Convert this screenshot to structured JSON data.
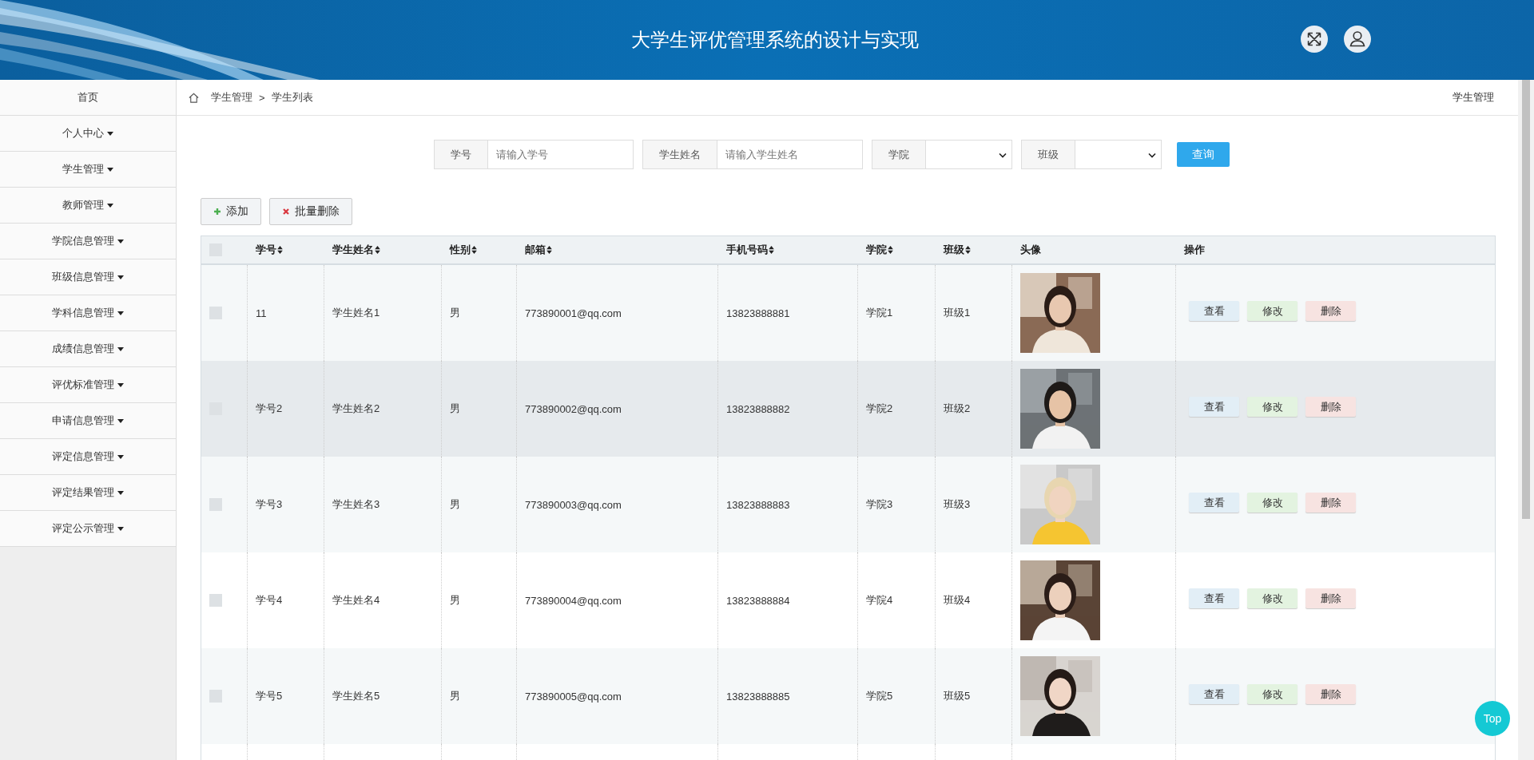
{
  "header": {
    "title": "大学生评优管理系统的设计与实现"
  },
  "sidebar": {
    "items": [
      {
        "label": "首页",
        "has_menu": false
      },
      {
        "label": "个人中心",
        "has_menu": true
      },
      {
        "label": "学生管理",
        "has_menu": true
      },
      {
        "label": "教师管理",
        "has_menu": true
      },
      {
        "label": "学院信息管理",
        "has_menu": true
      },
      {
        "label": "班级信息管理",
        "has_menu": true
      },
      {
        "label": "学科信息管理",
        "has_menu": true
      },
      {
        "label": "成绩信息管理",
        "has_menu": true
      },
      {
        "label": "评优标准管理",
        "has_menu": true
      },
      {
        "label": "申请信息管理",
        "has_menu": true
      },
      {
        "label": "评定信息管理",
        "has_menu": true
      },
      {
        "label": "评定结果管理",
        "has_menu": true
      },
      {
        "label": "评定公示管理",
        "has_menu": true
      }
    ]
  },
  "breadcrumb": {
    "parts": [
      "学生管理",
      "学生列表"
    ],
    "separator": ">",
    "page_label": "学生管理"
  },
  "search": {
    "fields": [
      {
        "kind": "input",
        "label": "学号",
        "placeholder": "请输入学号"
      },
      {
        "kind": "input",
        "label": "学生姓名",
        "placeholder": "请输入学生姓名"
      },
      {
        "kind": "select",
        "label": "学院"
      },
      {
        "kind": "select",
        "label": "班级"
      }
    ],
    "button": "查询"
  },
  "toolbar": [
    {
      "kind": "add",
      "label": "添加"
    },
    {
      "kind": "delete",
      "label": "批量删除"
    }
  ],
  "table": {
    "select_all": {
      "checked": false
    },
    "columns": [
      {
        "label": "学号",
        "sortable": true
      },
      {
        "label": "学生姓名",
        "sortable": true
      },
      {
        "label": "性别",
        "sortable": true
      },
      {
        "label": "邮箱",
        "sortable": true
      },
      {
        "label": "手机号码",
        "sortable": true
      },
      {
        "label": "学院",
        "sortable": true
      },
      {
        "label": "班级",
        "sortable": true
      },
      {
        "label": "头像",
        "sortable": false
      },
      {
        "label": "操作",
        "sortable": false
      }
    ],
    "rows": [
      {
        "checked": false,
        "hovered": false,
        "cells": [
          "11",
          "学生姓名1",
          "男",
          "773890001@qq.com",
          "13823888881",
          "学院1",
          "班级1"
        ],
        "avatar": {
          "kind": "picture"
        },
        "actions": [
          "查看",
          "修改",
          "删除"
        ]
      },
      {
        "checked": false,
        "hovered": true,
        "cells": [
          "学号2",
          "学生姓名2",
          "男",
          "773890002@qq.com",
          "13823888882",
          "学院2",
          "班级2"
        ],
        "avatar": {
          "kind": "picture"
        },
        "actions": [
          "查看",
          "修改",
          "删除"
        ]
      },
      {
        "checked": false,
        "hovered": false,
        "cells": [
          "学号3",
          "学生姓名3",
          "男",
          "773890003@qq.com",
          "13823888883",
          "学院3",
          "班级3"
        ],
        "avatar": {
          "kind": "picture"
        },
        "actions": [
          "查看",
          "修改",
          "删除"
        ]
      },
      {
        "checked": false,
        "hovered": false,
        "cells": [
          "学号4",
          "学生姓名4",
          "男",
          "773890004@qq.com",
          "13823888884",
          "学院4",
          "班级4"
        ],
        "avatar": {
          "kind": "picture"
        },
        "actions": [
          "查看",
          "修改",
          "删除"
        ]
      },
      {
        "checked": false,
        "hovered": false,
        "cells": [
          "学号5",
          "学生姓名5",
          "男",
          "773890005@qq.com",
          "13823888885",
          "学院5",
          "班级5"
        ],
        "avatar": {
          "kind": "picture"
        },
        "actions": [
          "查看",
          "修改",
          "删除"
        ]
      }
    ]
  },
  "top_button": "Top"
}
